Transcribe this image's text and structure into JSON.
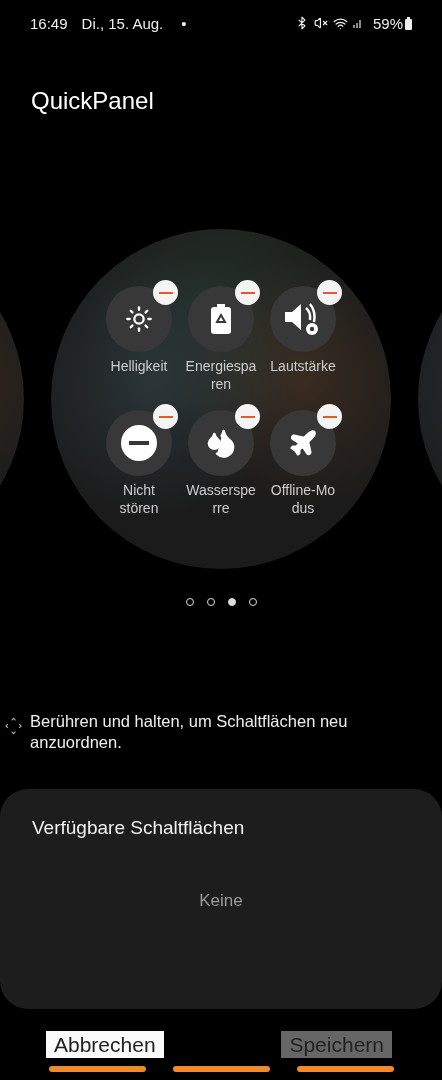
{
  "status_bar": {
    "time": "16:49",
    "date": "Di., 15. Aug.",
    "notification_dot": "•",
    "battery": "59%"
  },
  "title": "QuickPanel",
  "tiles": [
    {
      "kind": "brightness",
      "label": "Helligkeit",
      "removable": true
    },
    {
      "kind": "battery",
      "label": "Energiespa\nren",
      "removable": true
    },
    {
      "kind": "volume",
      "label": "Lautstärke",
      "removable": true
    },
    {
      "kind": "dnd",
      "label": "Nicht\nstören",
      "removable": true
    },
    {
      "kind": "water",
      "label": "Wasserspe\nrre",
      "removable": true
    },
    {
      "kind": "plane",
      "label": "Offline-Mo\ndus",
      "removable": true
    }
  ],
  "pages": [
    {
      "selected": false
    },
    {
      "selected": false
    },
    {
      "selected": true
    },
    {
      "selected": false
    }
  ],
  "hint": "Berühren und halten, um Schaltflächen neu anzuordnen.",
  "available": {
    "title": "Verfügbare Schaltflächen",
    "empty_text": "Keine"
  },
  "buttons": [
    {
      "label": "Abbrechen",
      "disabled": false
    },
    {
      "label": "Speichern",
      "disabled": true
    }
  ]
}
